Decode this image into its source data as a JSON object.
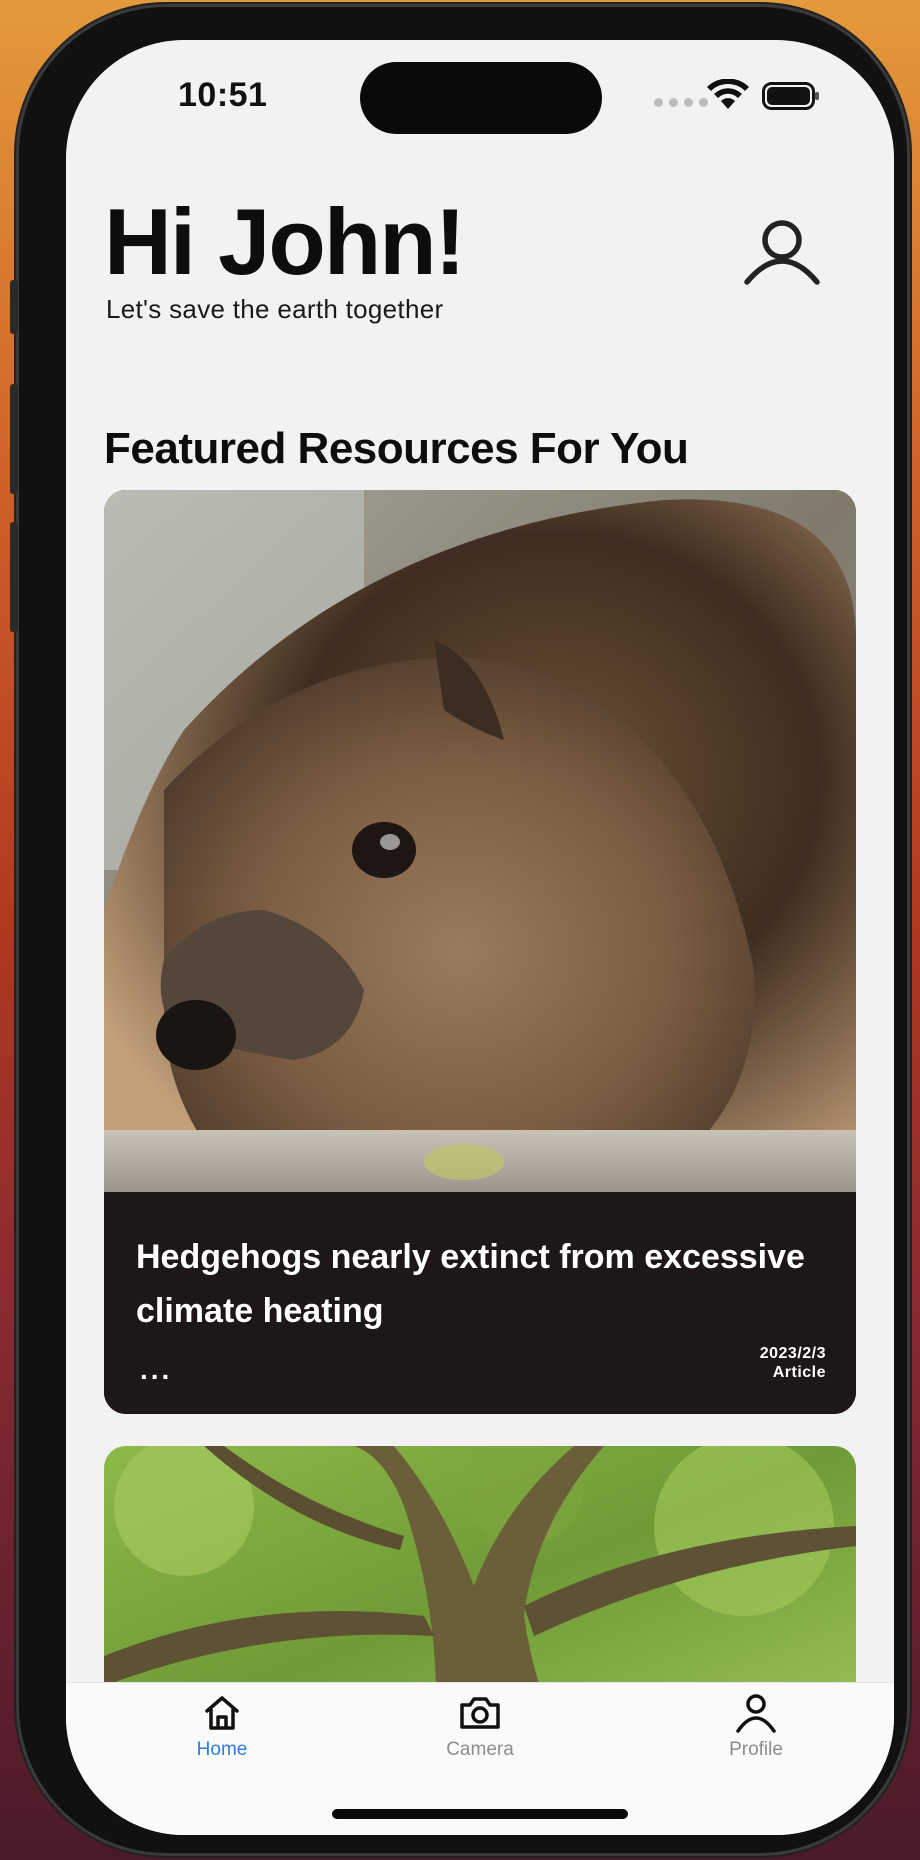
{
  "status_bar": {
    "time": "10:51"
  },
  "header": {
    "greeting": "Hi John!",
    "subtitle": "Let's save the earth together",
    "profile_icon": "person-icon"
  },
  "featured": {
    "section_title": "Featured Resources For You",
    "cards": [
      {
        "image": "hedgehog-photo",
        "title": "Hedgehogs nearly extinct from excessive climate heating",
        "more": "...",
        "date": "2023/2/3",
        "type": "Article"
      },
      {
        "image": "tree-photo"
      }
    ]
  },
  "tab_bar": {
    "tabs": [
      {
        "label": "Home",
        "icon": "home-icon",
        "active": true
      },
      {
        "label": "Camera",
        "icon": "camera-icon",
        "active": false
      },
      {
        "label": "Profile",
        "icon": "person-icon",
        "active": false
      }
    ],
    "active_color": "#2f7fd8",
    "inactive_color": "#8d8d8d"
  }
}
